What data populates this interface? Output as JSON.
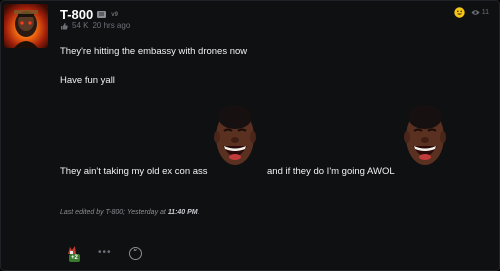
{
  "post": {
    "author": "T-800",
    "verified_label": "v9",
    "likes": "54 K",
    "time_ago": "20 hrs ago",
    "views": "11",
    "lines": [
      "They're hitting the embassy with drones now",
      "Have fun yall",
      "They ain't taking my old ex con ass",
      "and if they do I'm going AWOL"
    ],
    "edited_prefix": "Last edited by T-800; Yesterday at",
    "edited_time": "11:40 PM",
    "edited_suffix": ".",
    "reaction_count": "+2",
    "more_label": "•••",
    "quote_label": "“"
  },
  "colors": {
    "background": "#0f1012",
    "text": "#f2f2f2",
    "muted": "#6d7077",
    "reaction_badge": "#3a7a2c",
    "emoji_yellow": "#f5c518"
  },
  "icons": [
    "avatar-image",
    "badge-icon",
    "thumbs-up-icon",
    "emoji-face-icon",
    "eye-icon",
    "laughing-face-image",
    "reaction-icon",
    "more-icon",
    "quote-icon"
  ]
}
